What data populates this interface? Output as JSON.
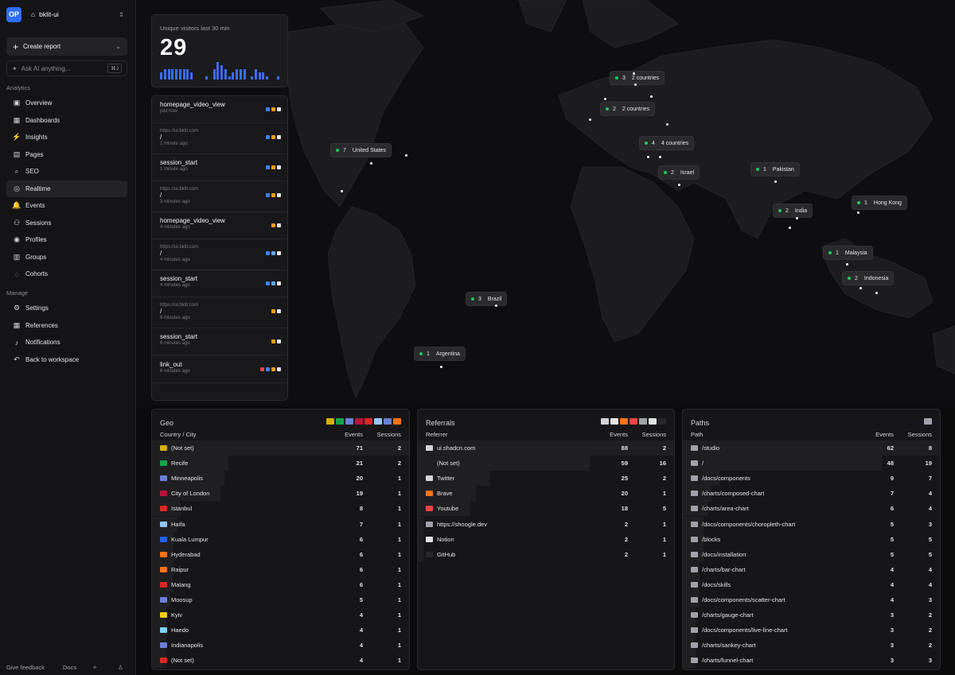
{
  "workspace": {
    "logo": "OP",
    "name": "bklit-ui"
  },
  "sidebar": {
    "create_report": "Create report",
    "ask_ai_placeholder": "Ask AI anything...",
    "ask_ai_shortcut": "⌘J",
    "analytics_label": "Analytics",
    "analytics_items": [
      {
        "label": "Overview",
        "icon": "overview-icon"
      },
      {
        "label": "Dashboards",
        "icon": "dashboards-icon"
      },
      {
        "label": "Insights",
        "icon": "insights-icon"
      },
      {
        "label": "Pages",
        "icon": "pages-icon"
      },
      {
        "label": "SEO",
        "icon": "search-icon"
      },
      {
        "label": "Realtime",
        "icon": "globe-icon",
        "active": true
      },
      {
        "label": "Events",
        "icon": "events-icon"
      },
      {
        "label": "Sessions",
        "icon": "users-icon"
      },
      {
        "label": "Profiles",
        "icon": "profile-icon"
      },
      {
        "label": "Groups",
        "icon": "groups-icon"
      },
      {
        "label": "Cohorts",
        "icon": "cohorts-icon"
      }
    ],
    "manage_label": "Manage",
    "manage_items": [
      {
        "label": "Settings",
        "icon": "gear-icon"
      },
      {
        "label": "References",
        "icon": "table-icon"
      },
      {
        "label": "Notifications",
        "icon": "bell-icon"
      },
      {
        "label": "Back to workspace",
        "icon": "back-icon"
      }
    ],
    "footer": {
      "feedback": "Give feedback",
      "docs": "Docs"
    }
  },
  "visitors": {
    "title": "Unique visitors last 30 min",
    "count": "29",
    "bars": [
      2,
      3,
      3,
      3,
      3,
      3,
      3,
      3,
      2,
      0,
      0,
      0,
      1,
      0,
      3,
      5,
      4,
      3,
      1,
      2,
      3,
      3,
      3,
      0,
      1,
      3,
      2,
      2,
      1,
      0,
      0,
      1
    ]
  },
  "feed": [
    {
      "url": "",
      "name": "homepage_video_view",
      "time": "just now"
    },
    {
      "url": "https://ui.bklit.com",
      "name": "/",
      "time": "1 minute ago"
    },
    {
      "url": "",
      "name": "session_start",
      "time": "1 minute ago"
    },
    {
      "url": "https://ui.bklit.com",
      "name": "/",
      "time": "3 minutes ago"
    },
    {
      "url": "",
      "name": "homepage_video_view",
      "time": "4 minutes ago"
    },
    {
      "url": "https://ui.bklit.com",
      "name": "/",
      "time": "4 minutes ago"
    },
    {
      "url": "",
      "name": "session_start",
      "time": "4 minutes ago"
    },
    {
      "url": "https://ui.bklit.com",
      "name": "/",
      "time": "6 minutes ago"
    },
    {
      "url": "",
      "name": "session_start",
      "time": "6 minutes ago"
    },
    {
      "url": "",
      "name": "link_out",
      "time": "6 minutes ago"
    }
  ],
  "markers": [
    {
      "count": "3",
      "label": "2 countries"
    },
    {
      "count": "2",
      "label": "2 countries"
    },
    {
      "count": "7",
      "label": "United States"
    },
    {
      "count": "4",
      "label": "4 countries"
    },
    {
      "count": "2",
      "label": "Israel"
    },
    {
      "count": "1",
      "label": "Pakistan"
    },
    {
      "count": "1",
      "label": "Hong Kong"
    },
    {
      "count": "2",
      "label": "India"
    },
    {
      "count": "1",
      "label": "Malaysia"
    },
    {
      "count": "2",
      "label": "Indonesia"
    },
    {
      "count": "3",
      "label": "Brazil"
    },
    {
      "count": "1",
      "label": "Argentina"
    }
  ],
  "geo": {
    "title": "Geo",
    "col1": "Country / City",
    "col2": "Events",
    "col3": "Sessions",
    "rows": [
      {
        "label": "(Not set)",
        "events": "71",
        "sessions": "2",
        "flag": "#d4b106"
      },
      {
        "label": "Recife",
        "events": "21",
        "sessions": "2",
        "flag": "#16a34a"
      },
      {
        "label": "Minneapolis",
        "events": "20",
        "sessions": "1",
        "flag": "#6b7fd7"
      },
      {
        "label": "City of London",
        "events": "19",
        "sessions": "1",
        "flag": "#be123c"
      },
      {
        "label": "Istanbul",
        "events": "8",
        "sessions": "1",
        "flag": "#dc2626"
      },
      {
        "label": "Haifa",
        "events": "7",
        "sessions": "1",
        "flag": "#93c5fd"
      },
      {
        "label": "Kuala Lumpur",
        "events": "6",
        "sessions": "1",
        "flag": "#2563eb"
      },
      {
        "label": "Hyderabad",
        "events": "6",
        "sessions": "1",
        "flag": "#f97316"
      },
      {
        "label": "Raipur",
        "events": "6",
        "sessions": "1",
        "flag": "#f97316"
      },
      {
        "label": "Malang",
        "events": "6",
        "sessions": "1",
        "flag": "#dc2626"
      },
      {
        "label": "Moosup",
        "events": "5",
        "sessions": "1",
        "flag": "#6b7fd7"
      },
      {
        "label": "Kyiv",
        "events": "4",
        "sessions": "1",
        "flag": "#facc15"
      },
      {
        "label": "Haedo",
        "events": "4",
        "sessions": "1",
        "flag": "#7dd3fc"
      },
      {
        "label": "Indianapolis",
        "events": "4",
        "sessions": "1",
        "flag": "#6b7fd7"
      },
      {
        "label": "(Not set)",
        "events": "4",
        "sessions": "1",
        "flag": "#dc2626"
      }
    ]
  },
  "referrals": {
    "title": "Referrals",
    "col1": "Referrer",
    "col2": "Events",
    "col3": "Sessions",
    "rows": [
      {
        "label": "ui.shadcn.com",
        "events": "88",
        "sessions": "2",
        "flag": "#d4d4d8"
      },
      {
        "label": "(Not set)",
        "events": "59",
        "sessions": "16",
        "flag": ""
      },
      {
        "label": "Twitter",
        "events": "25",
        "sessions": "2",
        "flag": "#d4d4d8"
      },
      {
        "label": "Brave",
        "events": "20",
        "sessions": "1",
        "flag": "#f97316"
      },
      {
        "label": "Youtube",
        "events": "18",
        "sessions": "5",
        "flag": "#ef4444"
      },
      {
        "label": "https://shoogle.dev",
        "events": "2",
        "sessions": "1",
        "flag": "#a1a1aa"
      },
      {
        "label": "Notion",
        "events": "2",
        "sessions": "1",
        "flag": "#e4e4e7"
      },
      {
        "label": "GitHub",
        "events": "2",
        "sessions": "1",
        "flag": "#27272a"
      }
    ]
  },
  "paths": {
    "title": "Paths",
    "col1": "Path",
    "col2": "Events",
    "col3": "Sessions",
    "rows": [
      {
        "label": "/studio",
        "events": "62",
        "sessions": "8"
      },
      {
        "label": "/",
        "events": "48",
        "sessions": "19"
      },
      {
        "label": "/docs/components",
        "events": "9",
        "sessions": "7"
      },
      {
        "label": "/charts/composed-chart",
        "events": "7",
        "sessions": "4"
      },
      {
        "label": "/charts/area-chart",
        "events": "6",
        "sessions": "4"
      },
      {
        "label": "/docs/components/choropleth-chart",
        "events": "5",
        "sessions": "3"
      },
      {
        "label": "/blocks",
        "events": "5",
        "sessions": "5"
      },
      {
        "label": "/docs/installation",
        "events": "5",
        "sessions": "5"
      },
      {
        "label": "/charts/bar-chart",
        "events": "4",
        "sessions": "4"
      },
      {
        "label": "/docs/skills",
        "events": "4",
        "sessions": "4"
      },
      {
        "label": "/docs/components/scatter-chart",
        "events": "4",
        "sessions": "3"
      },
      {
        "label": "/charts/gauge-chart",
        "events": "3",
        "sessions": "2"
      },
      {
        "label": "/docs/components/live-line-chart",
        "events": "3",
        "sessions": "2"
      },
      {
        "label": "/charts/sankey-chart",
        "events": "3",
        "sessions": "2"
      },
      {
        "label": "/charts/funnel-chart",
        "events": "3",
        "sessions": "3"
      }
    ]
  }
}
